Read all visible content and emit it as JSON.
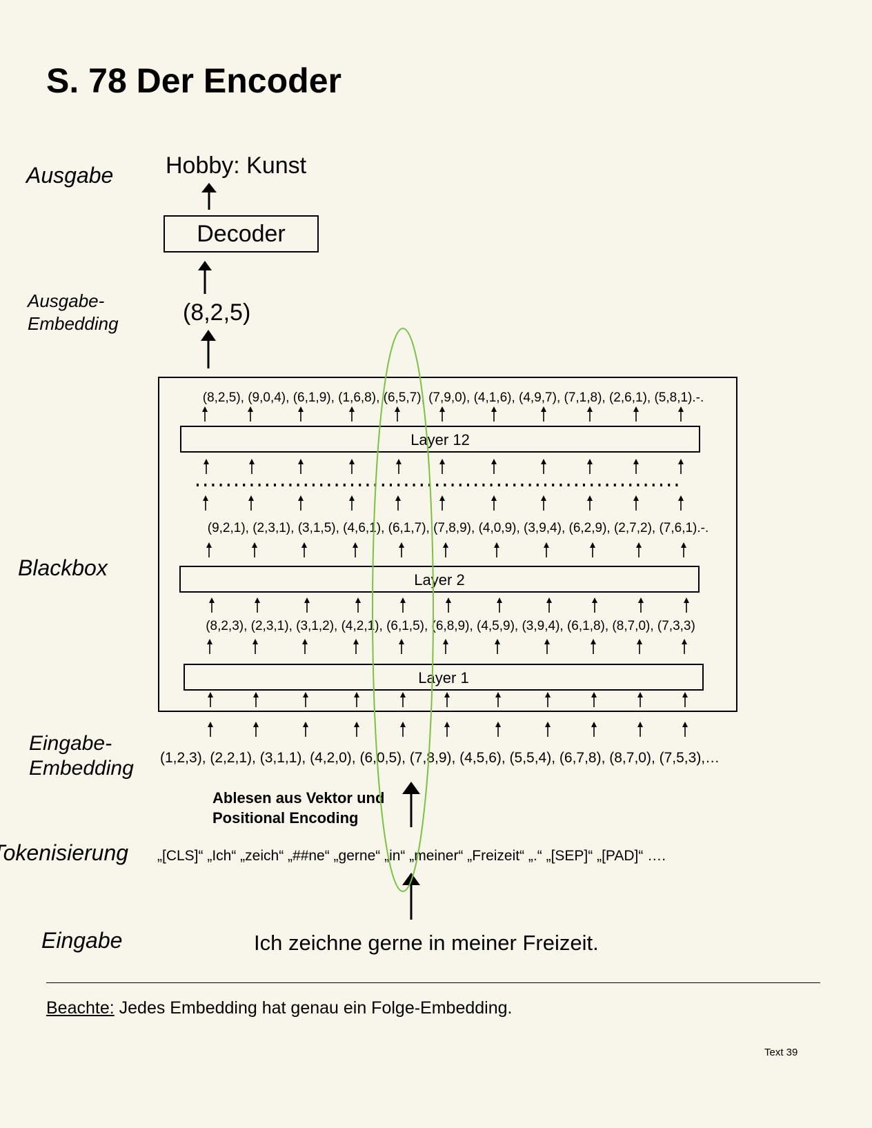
{
  "title": "S. 78 Der Encoder",
  "side_labels": {
    "ausgabe": "Ausgabe",
    "ausgabe_embedding_1": "Ausgabe-",
    "ausgabe_embedding_2": "Embedding",
    "blackbox": "Blackbox",
    "eingabe_embedding_1": "Eingabe-",
    "eingabe_embedding_2": "Embedding",
    "tokenisierung": "Tokenisierung",
    "eingabe": "Eingabe"
  },
  "output_text": "Hobby: Kunst",
  "decoder_label": "Decoder",
  "output_embedding": "(8,2,5)",
  "layers": {
    "layer12": "Layer 12",
    "layer2": "Layer 2",
    "layer1": "Layer 1"
  },
  "row_top": "(8,2,5), (9,0,4), (6,1,9), (1,6,8), (6,5,7), (7,9,0), (4,1,6), (4,9,7), (7,1,8), (2,6,1), (5,8,1).-.",
  "row_layer2_out": "(9,2,1), (2,3,1), (3,1,5), (4,6,1), (6,1,7), (7,8,9), (4,0,9), (3,9,4), (6,2,9), (2,7,2), (7,6,1).-.",
  "row_layer1_out": "(8,2,3), (2,3,1), (3,1,2), (4,2,1), (6,1,5), (6,8,9), (4,5,9), (3,9,4), (6,1,8), (8,7,0), (7,3,3)",
  "row_input_embedding": "(1,2,3), (2,2,1), (3,1,1), (4,2,0), (6,0,5), (7,8,9), (4,5,6), (5,5,4), (6,7,8), (8,7,0), (7,5,3),…",
  "ablesen_1": "Ablesen aus Vektor und",
  "ablesen_2": "Positional Encoding",
  "tokens": "„[CLS]“  „Ich“  „zeich“  „##ne“  „gerne“  „in“  „meiner“  „Freizeit“  „.“  „[SEP]“  „[PAD]“  ….",
  "input_sentence": "Ich zeichne gerne in meiner Freizeit.",
  "note_label": "Beachte:",
  "note_text": " Jedes Embedding hat genau ein Folge-Embedding.",
  "footer": "Text 39",
  "colors": {
    "background": "#f8f6ea",
    "highlight_ellipse": "#7cc242"
  }
}
